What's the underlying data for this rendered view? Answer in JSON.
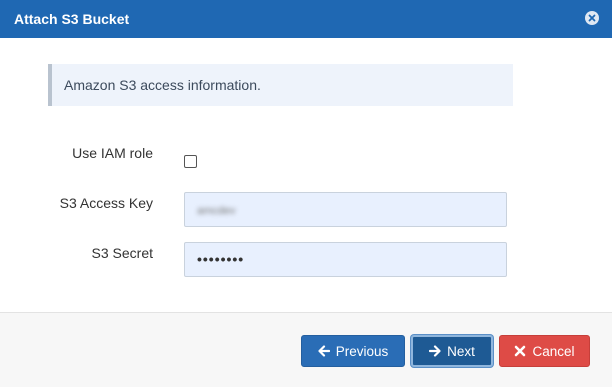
{
  "dialog": {
    "title": "Attach S3 Bucket",
    "close_icon": "close-circle-icon"
  },
  "info": {
    "text": "Amazon S3 access information."
  },
  "form": {
    "iam_label": "Use IAM role",
    "iam_checked": false,
    "access_key_label": "S3 Access Key",
    "access_key_value": "amcdev",
    "secret_label": "S3 Secret",
    "secret_value": "••••••••"
  },
  "footer": {
    "previous_label": "Previous",
    "previous_icon": "arrow-left-icon",
    "next_label": "Next",
    "next_icon": "arrow-right-icon",
    "cancel_label": "Cancel",
    "cancel_icon": "x-icon"
  },
  "colors": {
    "titlebar": "#1f68b3",
    "primary_button": "#2a6db6",
    "focused_button": "#1e5a94",
    "danger_button": "#de4b46",
    "input_bg": "#e8f0fe"
  }
}
